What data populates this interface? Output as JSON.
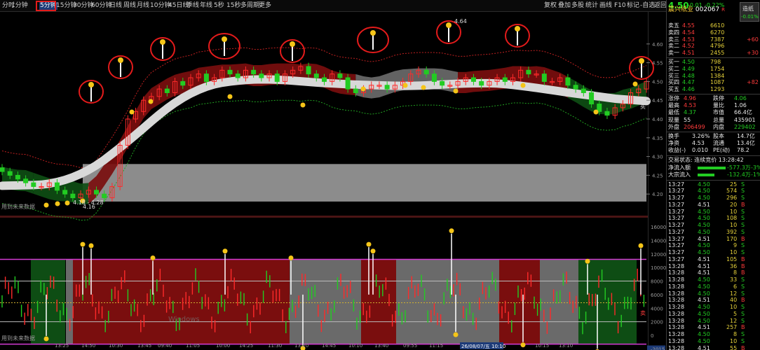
{
  "toolbar": {
    "left": [
      "分时",
      "1分钟",
      "5分钟",
      "15分钟",
      "30分钟",
      "60分钟",
      "日线",
      "周线",
      "月线",
      "10分钟",
      "45日线",
      "季线",
      "年线",
      "5秒",
      "15秒",
      "多周期",
      "更多"
    ],
    "active_index": 2,
    "right": [
      "复权",
      "叠加",
      "多股",
      "统计",
      "画线",
      "F10",
      "标记",
      "-自选",
      "返回"
    ]
  },
  "stock": {
    "name": "晨兴纸业",
    "code": "002067",
    "badge": "R",
    "price": "4.50",
    "change": "-0.01",
    "pct": "-0.22%",
    "sector": "造纸",
    "sector_pct": "-0.01%"
  },
  "asks": [
    {
      "label": "卖五",
      "price": "4.55",
      "vol": "6610",
      "chg": ""
    },
    {
      "label": "卖四",
      "price": "4.54",
      "vol": "6270",
      "chg": ""
    },
    {
      "label": "卖三",
      "price": "4.53",
      "vol": "7387",
      "chg": "+60"
    },
    {
      "label": "卖二",
      "price": "4.52",
      "vol": "4796",
      "chg": ""
    },
    {
      "label": "卖一",
      "price": "4.51",
      "vol": "2455",
      "chg": "+30"
    }
  ],
  "bids": [
    {
      "label": "买一",
      "price": "4.50",
      "vol": "798",
      "chg": ""
    },
    {
      "label": "买二",
      "price": "4.49",
      "vol": "1754",
      "chg": ""
    },
    {
      "label": "买三",
      "price": "4.48",
      "vol": "1384",
      "chg": ""
    },
    {
      "label": "买四",
      "price": "4.47",
      "vol": "1087",
      "chg": "+82"
    },
    {
      "label": "买五",
      "price": "4.46",
      "vol": "1293",
      "chg": ""
    }
  ],
  "stats": [
    {
      "l1": "涨停",
      "v1": "4.96",
      "c1": "red",
      "l2": "跌停",
      "v2": "4.06",
      "c2": "grn"
    },
    {
      "l1": "最高",
      "v1": "4.53",
      "c1": "red",
      "l2": "量比",
      "v2": "1.06",
      "c2": "wht"
    },
    {
      "l1": "最低",
      "v1": "4.37",
      "c1": "grn",
      "l2": "市值",
      "v2": "66.4亿",
      "c2": "wht"
    },
    {
      "l1": "现量",
      "v1": "55",
      "c1": "wht",
      "l2": "总量",
      "v2": "435901",
      "c2": "wht"
    },
    {
      "l1": "外盘",
      "v1": "206499",
      "c1": "red",
      "l2": "内盘",
      "v2": "229402",
      "c2": "grn"
    }
  ],
  "stats2": [
    {
      "l1": "换手",
      "v1": "3.26%",
      "l2": "股本",
      "v2": "14.7亿"
    },
    {
      "l1": "净资",
      "v1": "4.53",
      "l2": "流通",
      "v2": "13.4亿"
    },
    {
      "l1": "收益(-)",
      "v1": "0.010",
      "l2": "PE(动)",
      "v2": "78.2"
    }
  ],
  "trade_state": "交易状态: 连续竞价 13:28:42",
  "flows": [
    {
      "label": "净流入额",
      "value": "-577.3万",
      "pct": "-3%"
    },
    {
      "label": "大宗流入",
      "value": "-132.4万",
      "pct": "-1%"
    }
  ],
  "ticks": [
    [
      "13:27",
      "4.50",
      "25",
      "S"
    ],
    [
      "13:27",
      "4.50",
      "574",
      "S"
    ],
    [
      "13:27",
      "4.50",
      "296",
      "S"
    ],
    [
      "13:27",
      "4.51",
      "20",
      "B"
    ],
    [
      "13:27",
      "4.50",
      "10",
      "S"
    ],
    [
      "13:27",
      "4.50",
      "108",
      "S"
    ],
    [
      "13:27",
      "4.50",
      "10",
      "S"
    ],
    [
      "13:27",
      "4.50",
      "392",
      "S"
    ],
    [
      "13:27",
      "4.51",
      "170",
      "B"
    ],
    [
      "13:27",
      "4.50",
      "9",
      "S"
    ],
    [
      "13:27",
      "4.50",
      "10",
      "S"
    ],
    [
      "13:27",
      "4.51",
      "105",
      "B"
    ],
    [
      "13:28",
      "4.51",
      "36",
      "B"
    ],
    [
      "13:28",
      "4.51",
      "8",
      "B"
    ],
    [
      "13:28",
      "4.50",
      "33",
      "S"
    ],
    [
      "13:28",
      "4.50",
      "6",
      "S"
    ],
    [
      "13:28",
      "4.50",
      "12",
      "S"
    ],
    [
      "13:28",
      "4.51",
      "40",
      "B"
    ],
    [
      "13:28",
      "4.50",
      "10",
      "S"
    ],
    [
      "13:28",
      "4.50",
      "5",
      "S"
    ],
    [
      "13:28",
      "4.50",
      "12",
      "S"
    ],
    [
      "13:28",
      "4.51",
      "257",
      "B"
    ],
    [
      "13:28",
      "4.50",
      "8",
      "S"
    ],
    [
      "13:28",
      "4.50",
      "10",
      "S"
    ],
    [
      "13:28",
      "4.51",
      "55",
      "B"
    ]
  ],
  "chart_data": {
    "type": "candlestick",
    "upper_yaxis": {
      "ticks": [
        "4.60",
        "4.55",
        "4.50",
        "4.45",
        "4.40",
        "4.35",
        "4.30",
        "4.25",
        "4.20"
      ],
      "ylim": [
        4.15,
        4.65
      ]
    },
    "lower_yaxis": {
      "ticks": [
        "16000",
        "14000",
        "12000",
        "10000",
        "8000",
        "6000",
        "4000",
        "2000",
        "0",
        "-2015"
      ]
    },
    "x_labels": [
      "13:25",
      "14:50",
      "10:30",
      "13:45",
      "09:40",
      "11:05",
      "10:00",
      "14:25",
      "11:30",
      "13:20",
      "14:45",
      "10:10",
      "13:40",
      "09:55",
      "11:15",
      "13:30",
      "14:20",
      "10:15",
      "13:10"
    ],
    "date_label": "26/08/07/五 10:10",
    "annotations": {
      "high": "4.64",
      "low_pair": "4.18 - 4.28",
      "low": "4.16"
    },
    "labels": [
      "用到未来数据",
      "用到未来数据"
    ],
    "markers": [
      "买",
      "卖"
    ],
    "watermark": "Windows",
    "series": [
      {
        "name": "candles",
        "values": [
          4.26,
          4.25,
          4.24,
          4.23,
          4.22,
          4.22,
          4.23,
          4.21,
          4.2,
          4.19,
          4.2,
          4.21,
          4.2,
          4.19,
          4.22,
          4.33,
          4.4,
          4.42,
          4.45,
          4.46,
          4.48,
          4.47,
          4.5,
          4.49,
          4.51,
          4.52,
          4.5,
          4.51,
          4.53,
          4.52,
          4.51,
          4.53,
          4.52,
          4.51,
          4.52,
          4.5,
          4.52,
          4.53,
          4.54,
          4.52,
          4.51,
          4.5,
          4.52,
          4.51,
          4.48,
          4.47,
          4.48,
          4.49,
          4.49,
          4.48,
          4.49,
          4.5,
          4.52,
          4.53,
          4.52,
          4.5,
          4.49,
          4.49,
          4.5,
          4.51,
          4.5,
          4.49,
          4.5,
          4.51,
          4.5,
          4.51,
          4.53,
          4.52,
          4.52,
          4.5,
          4.5,
          4.51,
          4.49,
          4.48,
          4.47,
          4.44,
          4.42,
          4.41,
          4.43,
          4.44,
          4.47,
          4.48,
          4.5
        ]
      }
    ]
  }
}
